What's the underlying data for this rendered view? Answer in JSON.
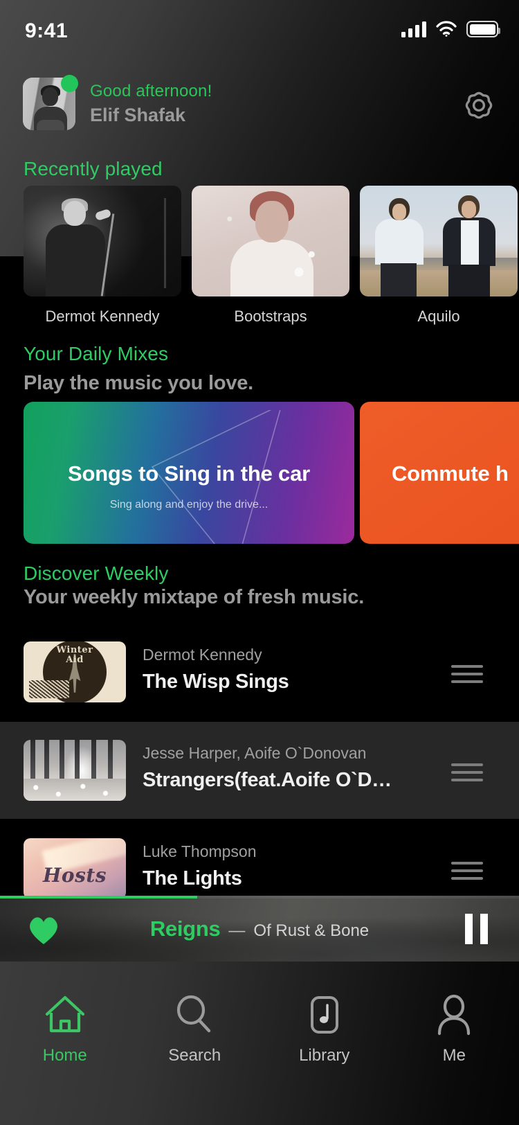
{
  "status_bar": {
    "time": "9:41",
    "signal_icon": "cellular-signal-icon",
    "wifi_icon": "wifi-icon",
    "battery_icon": "battery-full-icon"
  },
  "header": {
    "greeting": "Good afternoon!",
    "user_name": "Elif Shafak",
    "avatar_name": "user-avatar",
    "online_status": "online",
    "settings_icon": "gear-icon",
    "accent_color": "#29c75a"
  },
  "recently_played": {
    "section_title": "Recently played",
    "cards": [
      {
        "label": "Dermot Kennedy"
      },
      {
        "label": "Bootstraps"
      },
      {
        "label": "Aquilo"
      }
    ]
  },
  "daily_mixes": {
    "section_title": "Your Daily Mixes",
    "section_subtitle": "Play the music you love.",
    "cards": [
      {
        "title": "Songs to Sing in the car",
        "description": "Sing along and enjoy the drive...",
        "color": "#236f9e"
      },
      {
        "title": "Commute h",
        "description": "",
        "color": "#ef5d29"
      }
    ]
  },
  "discover_weekly": {
    "section_title": "Discover Weekly",
    "section_subtitle": "Your weekly mixtape of fresh music.",
    "tracks": [
      {
        "artist": "Dermot Kennedy",
        "title": "The Wisp Sings",
        "art": "winter-aid-artwork",
        "handle": "drag-handle-icon"
      },
      {
        "artist": "Jesse Harper,   Aoife O`Donovan",
        "title": "Strangers(feat.Aoife O`D…",
        "art": "misty-forest-artwork",
        "handle": "drag-handle-icon"
      },
      {
        "artist": "Luke Thompson",
        "title": "The Lights",
        "art": "hosts-artwork",
        "handle": "drag-handle-icon"
      }
    ]
  },
  "now_playing": {
    "song": "Reigns",
    "separator": "—",
    "album": "Of Rust & Bone",
    "progress_percent": 38,
    "progress_color": "#2ecc63",
    "like_icon": "heart-filled-icon",
    "transport_icon": "pause-icon"
  },
  "tabbar": {
    "items": [
      {
        "label": "Home",
        "icon": "home-icon",
        "active": true
      },
      {
        "label": "Search",
        "icon": "search-icon",
        "active": false
      },
      {
        "label": "Library",
        "icon": "library-icon",
        "active": false
      },
      {
        "label": "Me",
        "icon": "person-icon",
        "active": false
      }
    ]
  },
  "artwork_text": {
    "winter_aid_line1": "Winter",
    "winter_aid_line2": "Aid",
    "hosts_word": "Hosts"
  }
}
